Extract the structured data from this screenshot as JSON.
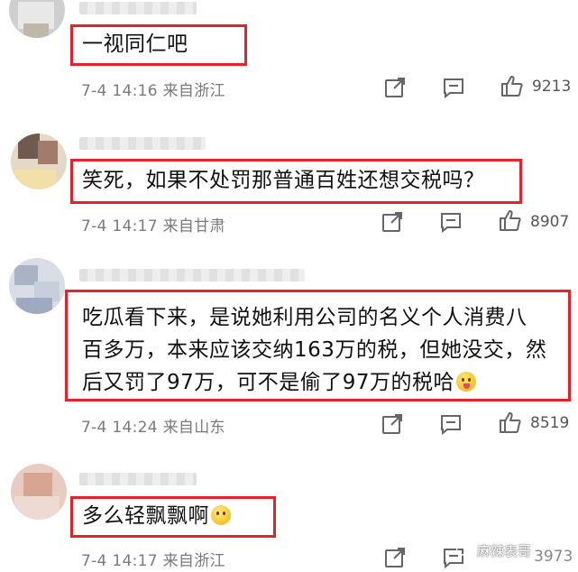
{
  "comments": [
    {
      "text": "一视同仁吧",
      "date": "7-4",
      "time": "14:16",
      "location": "来自浙江",
      "likes": "9213"
    },
    {
      "text": "笑死，如果不处罚那普通百姓还想交税吗？",
      "date": "7-4",
      "time": "14:17",
      "location": "来自甘肃",
      "likes": "8907"
    },
    {
      "text_lines": [
        "吃瓜看下来，是说她利用公司的名义个人消费八",
        "百多万，本来应该交纳163万的税，但她没交，然",
        "后又罚了97万，可不是偷了97万的税哈"
      ],
      "date": "7-4",
      "time": "14:24",
      "location": "来自山东",
      "likes": "8519"
    },
    {
      "text": "多么轻飘飘啊",
      "date": "7-4",
      "time": "14:17",
      "location": "来自浙江",
      "likes": "3973"
    }
  ],
  "icons": {
    "share": "share-icon",
    "comment": "comment-icon",
    "like": "thumbs-up-icon"
  },
  "watermark": "麻辣表哥",
  "colors": {
    "highlight_border": "#e8202a",
    "meta_text": "#7a7a7a"
  }
}
